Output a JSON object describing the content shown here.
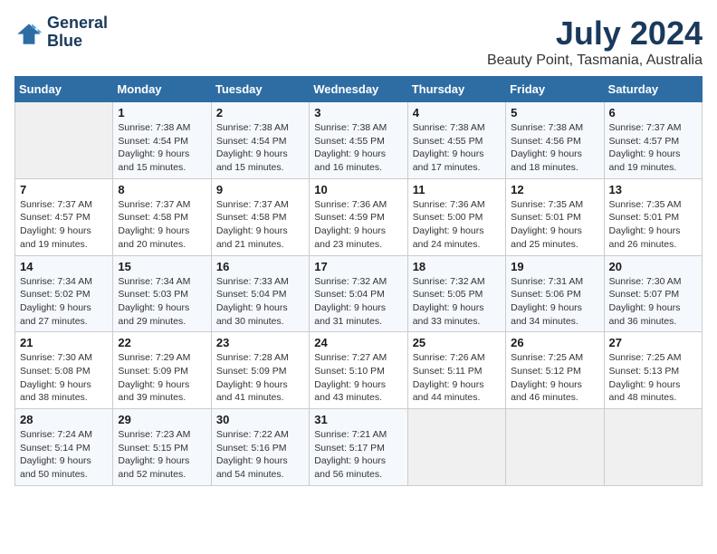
{
  "header": {
    "logo_line1": "General",
    "logo_line2": "Blue",
    "title": "July 2024",
    "subtitle": "Beauty Point, Tasmania, Australia"
  },
  "calendar": {
    "days_of_week": [
      "Sunday",
      "Monday",
      "Tuesday",
      "Wednesday",
      "Thursday",
      "Friday",
      "Saturday"
    ],
    "weeks": [
      [
        {
          "day": "",
          "detail": ""
        },
        {
          "day": "1",
          "detail": "Sunrise: 7:38 AM\nSunset: 4:54 PM\nDaylight: 9 hours\nand 15 minutes."
        },
        {
          "day": "2",
          "detail": "Sunrise: 7:38 AM\nSunset: 4:54 PM\nDaylight: 9 hours\nand 15 minutes."
        },
        {
          "day": "3",
          "detail": "Sunrise: 7:38 AM\nSunset: 4:55 PM\nDaylight: 9 hours\nand 16 minutes."
        },
        {
          "day": "4",
          "detail": "Sunrise: 7:38 AM\nSunset: 4:55 PM\nDaylight: 9 hours\nand 17 minutes."
        },
        {
          "day": "5",
          "detail": "Sunrise: 7:38 AM\nSunset: 4:56 PM\nDaylight: 9 hours\nand 18 minutes."
        },
        {
          "day": "6",
          "detail": "Sunrise: 7:37 AM\nSunset: 4:57 PM\nDaylight: 9 hours\nand 19 minutes."
        }
      ],
      [
        {
          "day": "7",
          "detail": "Sunrise: 7:37 AM\nSunset: 4:57 PM\nDaylight: 9 hours\nand 19 minutes."
        },
        {
          "day": "8",
          "detail": "Sunrise: 7:37 AM\nSunset: 4:58 PM\nDaylight: 9 hours\nand 20 minutes."
        },
        {
          "day": "9",
          "detail": "Sunrise: 7:37 AM\nSunset: 4:58 PM\nDaylight: 9 hours\nand 21 minutes."
        },
        {
          "day": "10",
          "detail": "Sunrise: 7:36 AM\nSunset: 4:59 PM\nDaylight: 9 hours\nand 23 minutes."
        },
        {
          "day": "11",
          "detail": "Sunrise: 7:36 AM\nSunset: 5:00 PM\nDaylight: 9 hours\nand 24 minutes."
        },
        {
          "day": "12",
          "detail": "Sunrise: 7:35 AM\nSunset: 5:01 PM\nDaylight: 9 hours\nand 25 minutes."
        },
        {
          "day": "13",
          "detail": "Sunrise: 7:35 AM\nSunset: 5:01 PM\nDaylight: 9 hours\nand 26 minutes."
        }
      ],
      [
        {
          "day": "14",
          "detail": "Sunrise: 7:34 AM\nSunset: 5:02 PM\nDaylight: 9 hours\nand 27 minutes."
        },
        {
          "day": "15",
          "detail": "Sunrise: 7:34 AM\nSunset: 5:03 PM\nDaylight: 9 hours\nand 29 minutes."
        },
        {
          "day": "16",
          "detail": "Sunrise: 7:33 AM\nSunset: 5:04 PM\nDaylight: 9 hours\nand 30 minutes."
        },
        {
          "day": "17",
          "detail": "Sunrise: 7:32 AM\nSunset: 5:04 PM\nDaylight: 9 hours\nand 31 minutes."
        },
        {
          "day": "18",
          "detail": "Sunrise: 7:32 AM\nSunset: 5:05 PM\nDaylight: 9 hours\nand 33 minutes."
        },
        {
          "day": "19",
          "detail": "Sunrise: 7:31 AM\nSunset: 5:06 PM\nDaylight: 9 hours\nand 34 minutes."
        },
        {
          "day": "20",
          "detail": "Sunrise: 7:30 AM\nSunset: 5:07 PM\nDaylight: 9 hours\nand 36 minutes."
        }
      ],
      [
        {
          "day": "21",
          "detail": "Sunrise: 7:30 AM\nSunset: 5:08 PM\nDaylight: 9 hours\nand 38 minutes."
        },
        {
          "day": "22",
          "detail": "Sunrise: 7:29 AM\nSunset: 5:09 PM\nDaylight: 9 hours\nand 39 minutes."
        },
        {
          "day": "23",
          "detail": "Sunrise: 7:28 AM\nSunset: 5:09 PM\nDaylight: 9 hours\nand 41 minutes."
        },
        {
          "day": "24",
          "detail": "Sunrise: 7:27 AM\nSunset: 5:10 PM\nDaylight: 9 hours\nand 43 minutes."
        },
        {
          "day": "25",
          "detail": "Sunrise: 7:26 AM\nSunset: 5:11 PM\nDaylight: 9 hours\nand 44 minutes."
        },
        {
          "day": "26",
          "detail": "Sunrise: 7:25 AM\nSunset: 5:12 PM\nDaylight: 9 hours\nand 46 minutes."
        },
        {
          "day": "27",
          "detail": "Sunrise: 7:25 AM\nSunset: 5:13 PM\nDaylight: 9 hours\nand 48 minutes."
        }
      ],
      [
        {
          "day": "28",
          "detail": "Sunrise: 7:24 AM\nSunset: 5:14 PM\nDaylight: 9 hours\nand 50 minutes."
        },
        {
          "day": "29",
          "detail": "Sunrise: 7:23 AM\nSunset: 5:15 PM\nDaylight: 9 hours\nand 52 minutes."
        },
        {
          "day": "30",
          "detail": "Sunrise: 7:22 AM\nSunset: 5:16 PM\nDaylight: 9 hours\nand 54 minutes."
        },
        {
          "day": "31",
          "detail": "Sunrise: 7:21 AM\nSunset: 5:17 PM\nDaylight: 9 hours\nand 56 minutes."
        },
        {
          "day": "",
          "detail": ""
        },
        {
          "day": "",
          "detail": ""
        },
        {
          "day": "",
          "detail": ""
        }
      ]
    ]
  }
}
